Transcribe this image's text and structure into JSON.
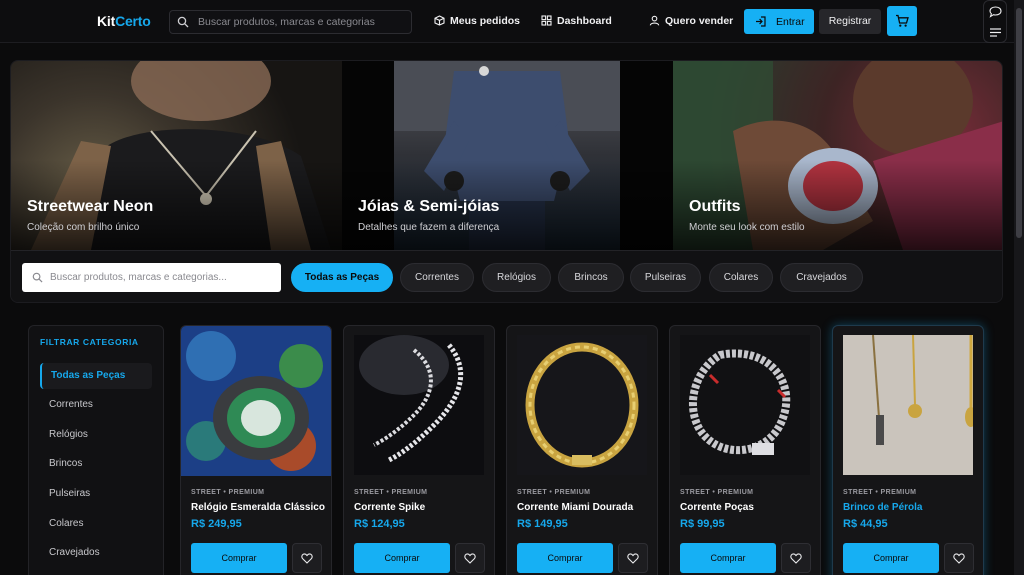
{
  "header": {
    "logo_part1": "Kit",
    "logo_part2": "Certo",
    "search_placeholder": "Buscar produtos, marcas e categorias",
    "nav": {
      "orders": "Meus pedidos",
      "dashboard": "Dashboard",
      "sell": "Quero vender",
      "login": "Entrar",
      "register": "Registrar"
    }
  },
  "hero": {
    "panels": [
      {
        "title": "Streetwear Neon",
        "subtitle": "Coleção com brilho único"
      },
      {
        "title": "Jóias & Semi-jóias",
        "subtitle": "Detalhes que fazem a diferença"
      },
      {
        "title": "Outfits",
        "subtitle": "Monte seu look com estilo"
      }
    ],
    "search_placeholder": "Buscar produtos, marcas e categorias...",
    "chips": [
      "Todas as Peças",
      "Correntes",
      "Relógios",
      "Brincos",
      "Pulseiras",
      "Colares",
      "Cravejados"
    ],
    "active_chip": "Todas as Peças"
  },
  "sidebar": {
    "title": "FILTRAR CATEGORIA",
    "items": [
      "Todas as Peças",
      "Correntes",
      "Relógios",
      "Brincos",
      "Pulseiras",
      "Colares",
      "Cravejados"
    ],
    "active": "Todas as Peças"
  },
  "products": [
    {
      "tag": "STREET • PREMIUM",
      "name": "Relógio Esmeralda Clássico",
      "price": "R$ 249,95",
      "buy": "Comprar"
    },
    {
      "tag": "STREET • PREMIUM",
      "name": "Corrente Spike",
      "price": "R$ 124,95",
      "buy": "Comprar"
    },
    {
      "tag": "STREET • PREMIUM",
      "name": "Corrente Miami Dourada",
      "price": "R$ 149,95",
      "buy": "Comprar"
    },
    {
      "tag": "STREET • PREMIUM",
      "name": "Corrente Poças",
      "price": "R$ 99,95",
      "buy": "Comprar"
    },
    {
      "tag": "STREET • PREMIUM",
      "name": "Brinco de Pérola",
      "price": "R$ 44,95",
      "buy": "Comprar"
    }
  ],
  "colors": {
    "accent": "#16b0f4",
    "background": "#0b0b0c",
    "card": "#151517"
  }
}
